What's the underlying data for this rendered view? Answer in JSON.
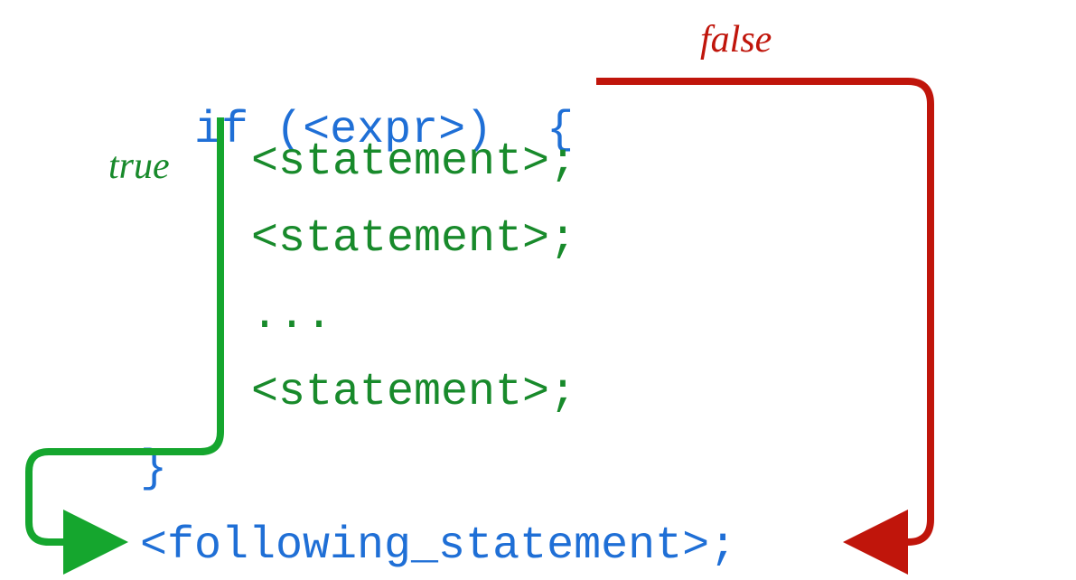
{
  "labels": {
    "true": "true",
    "false": "false"
  },
  "code": {
    "if": "if",
    "open_paren": "(",
    "expr": "<expr>",
    "close_paren": ")",
    "open_brace": "{",
    "stmt1": "<statement>;",
    "stmt2": "<statement>;",
    "dots": "...",
    "stmt3": "<statement>;",
    "close_brace": "}",
    "following": "<following_statement>;"
  },
  "colors": {
    "keyword": "#1f6fd6",
    "statement": "#188a2b",
    "true_arrow": "#15a62e",
    "false_arrow": "#c0150b"
  }
}
